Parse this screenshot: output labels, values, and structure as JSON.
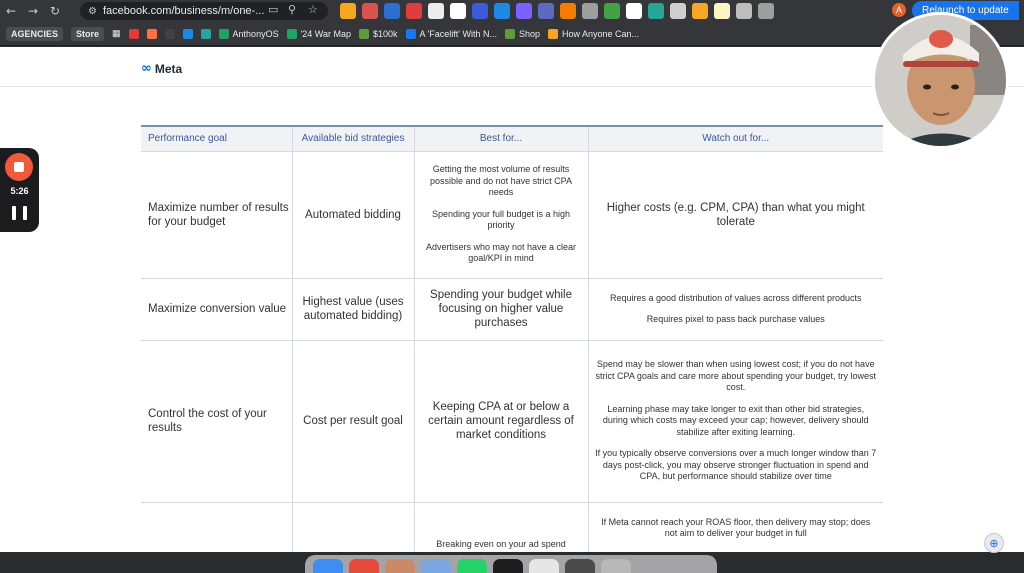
{
  "browser": {
    "url": "facebook.com/business/m/one-...",
    "relaunch_label": "Relaunch to update",
    "profile_initial": "A"
  },
  "bookmarks": [
    {
      "label": "AGENCIES",
      "kind": "chip"
    },
    {
      "label": "Store",
      "kind": "chip"
    },
    {
      "label": "AnthonyOS",
      "color": "#21a366"
    },
    {
      "label": "'24 War Map",
      "color": "#21a366"
    },
    {
      "label": "$100k",
      "color": "#5e9c3a"
    },
    {
      "label": "A 'Facelift' With N...",
      "color": "#1877f2"
    },
    {
      "label": "Shop",
      "color": "#5e9c3a"
    },
    {
      "label": "How Anyone Can...",
      "color": "#f5a623"
    }
  ],
  "meta_logo": {
    "mark": "∞",
    "word": "Meta"
  },
  "table": {
    "headers": [
      "Performance goal",
      "Available bid strategies",
      "Best for...",
      "Watch out for..."
    ],
    "rows": [
      {
        "goal": "Maximize number of results for your budget",
        "bid": "Automated bidding",
        "best_size": "small",
        "best": [
          "Getting the most volume of results possible and do not have strict CPA needs",
          "Spending your full budget is a high priority",
          "Advertisers who may not have a clear goal/KPI in mind"
        ],
        "watch_size": "big",
        "watch": [
          "Higher costs (e.g. CPM, CPA) than what you might tolerate"
        ]
      },
      {
        "goal": "Maximize conversion value",
        "bid": "Highest value (uses automated bidding)",
        "best_size": "big",
        "best": [
          "Spending your budget while focusing on higher value purchases"
        ],
        "watch_size": "small",
        "watch": [
          "Requires a good distribution of values across different products",
          "Requires pixel to pass back purchase values"
        ]
      },
      {
        "goal": "Control the cost of your results",
        "bid": "Cost per result goal",
        "best_size": "big",
        "best": [
          "Keeping CPA at or below a certain amount regardless of market conditions"
        ],
        "watch_size": "small",
        "watch": [
          "Spend may be slower than when using lowest cost; if you do not have strict CPA goals and care more about spending your budget, try lowest cost.",
          "Learning phase may take longer to exit than other bid strategies, during which costs may exceed your cap; however, delivery should stabilize after exiting learning.",
          "If you typically observe conversions over a much longer window than 7 days post-click, you may observe stronger fluctuation in spend and CPA, but performance should stabilize over time"
        ]
      },
      {
        "goal": "",
        "bid": "",
        "best_size": "small",
        "best": [
          "Breaking even on your ad spend"
        ],
        "watch_size": "small",
        "watch": [
          "If Meta cannot reach your ROAS floor, then delivery may stop; does not aim to deliver your budget in full"
        ]
      }
    ]
  },
  "recorder": {
    "time": "5:26"
  }
}
